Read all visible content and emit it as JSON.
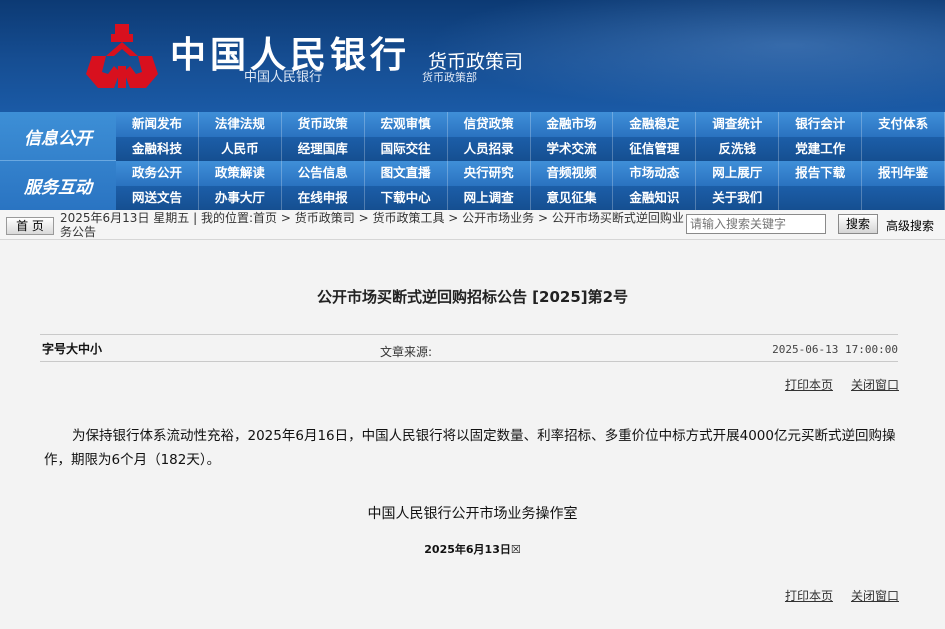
{
  "header": {
    "title": "中国人民银行",
    "subtitle": "中国人民银行",
    "department": "货币政策司",
    "department_sub": "货币政策部",
    "logo_icon": "pboc-logo-icon",
    "logo_color": "#d8101e"
  },
  "nav": {
    "section_labels": [
      "信息公开",
      "服务互动"
    ],
    "rows": [
      [
        "新闻发布",
        "法律法规",
        "货币政策",
        "宏观审慎",
        "信贷政策",
        "金融市场",
        "金融稳定",
        "调查统计",
        "银行会计",
        "支付体系"
      ],
      [
        "金融科技",
        "人民币",
        "经理国库",
        "国际交往",
        "人员招录",
        "学术交流",
        "征信管理",
        "反洗钱",
        "党建工作",
        ""
      ],
      [
        "政务公开",
        "政策解读",
        "公告信息",
        "图文直播",
        "央行研究",
        "音频视频",
        "市场动态",
        "网上展厅",
        "报告下载",
        "报刊年鉴"
      ],
      [
        "网送文告",
        "办事大厅",
        "在线申报",
        "下载中心",
        "网上调查",
        "意见征集",
        "金融知识",
        "关于我们",
        "",
        ""
      ]
    ]
  },
  "crumbbar": {
    "home_label": "首 页",
    "date": "2025年6月13日 星期五",
    "location_prefix": "我的位置:",
    "crumbs": [
      "首页",
      "货币政策司",
      "货币政策工具",
      "公开市场业务",
      "公开市场买断式逆回购业务公告"
    ],
    "search_placeholder": "请输入搜索关键字",
    "search_button": "搜索",
    "advanced_search": "高级搜索"
  },
  "article": {
    "title": "公开市场买断式逆回购招标公告 [2025]第2号",
    "font_size_toggle": "字号大中小",
    "source_label": "文章来源:",
    "publish_time": "2025-06-13 17:00:00",
    "print_label": "打印本页",
    "close_label": "关闭窗口",
    "body": "为保持银行体系流动性充裕，2025年6月16日，中国人民银行将以固定数量、利率招标、多重价位中标方式开展4000亿元买断式逆回购操作，期限为6个月（182天）。",
    "signoff": "中国人民银行公开市场业务操作室",
    "sign_date": "2025年6月13日☒"
  },
  "colors": {
    "header_bg": "#164e93",
    "nav_light": "#3f8fd8",
    "nav_dark": "#1c5ea8",
    "page_bg": "#f3f3f3"
  }
}
